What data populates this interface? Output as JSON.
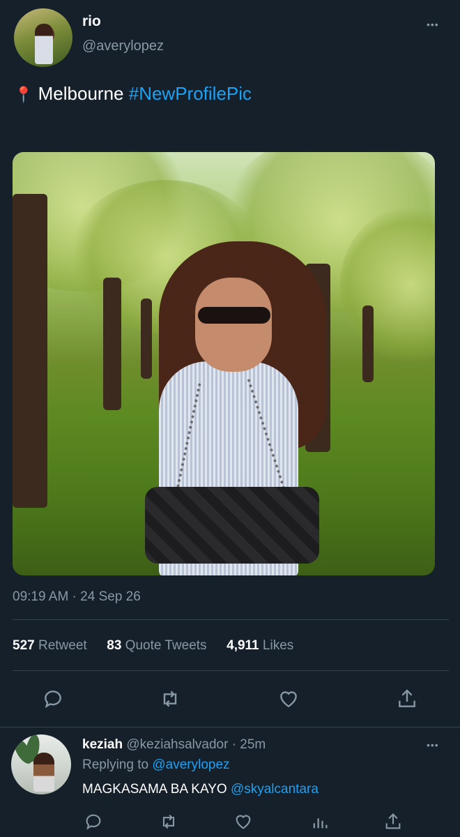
{
  "tweet": {
    "author_name": "rio",
    "author_handle": "@averylopez",
    "location_emoji": "📍",
    "text_main": "Melbourne",
    "hashtag": "#NewProfilePic",
    "timestamp": "09:19 AM · 24 Sep 26",
    "more_label": "•••"
  },
  "stats": {
    "retweets_count": "527",
    "retweets_label": "Retweet",
    "quotes_count": "83",
    "quotes_label": "Quote Tweets",
    "likes_count": "4,911",
    "likes_label": "Likes"
  },
  "actions": [
    "reply-icon",
    "retweet-icon",
    "like-icon",
    "share-icon"
  ],
  "reply": {
    "author_name": "keziah",
    "author_handle": "@keziahsalvador",
    "time": "· 25m",
    "replying_prefix": "Replying to",
    "replying_to": "@averylopez",
    "text": "MAGKASAMA BA KAYO",
    "mention": "@skyalcantara",
    "more_label": "•••"
  },
  "colors": {
    "background": "#15202b",
    "accent": "#1da1f2",
    "muted": "#8899a6",
    "divider": "#38444d"
  }
}
